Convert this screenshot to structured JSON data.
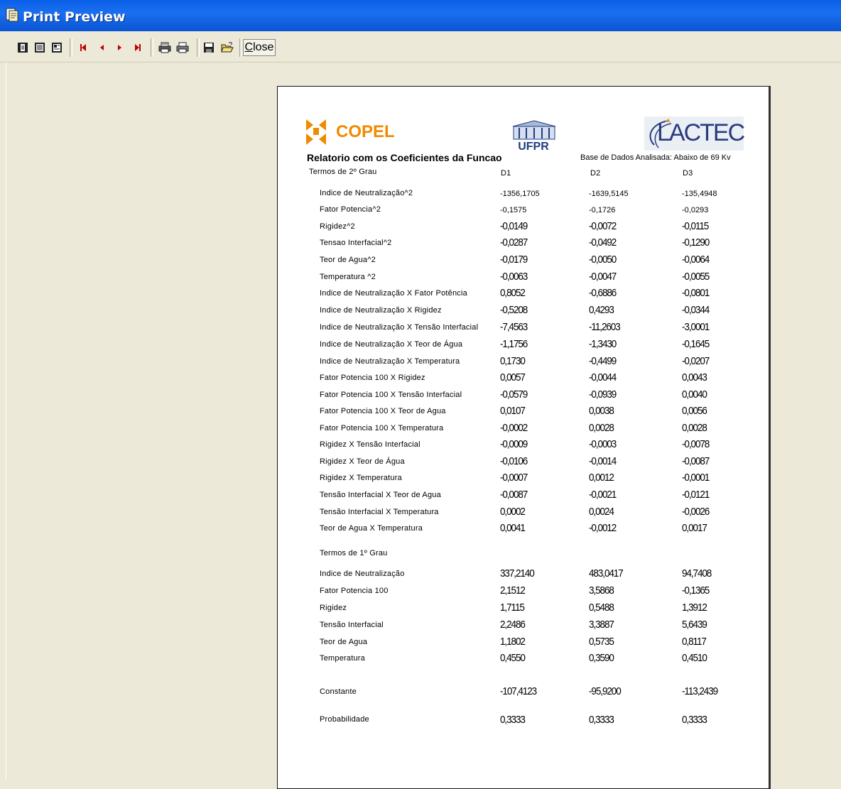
{
  "window": {
    "title": "Print Preview"
  },
  "toolbar": {
    "buttons": [
      {
        "icon": "one-page-icon"
      },
      {
        "icon": "two-pages-icon"
      },
      {
        "icon": "zoom-page-icon"
      },
      {
        "icon": "first-page-icon"
      },
      {
        "icon": "previous-page-icon"
      },
      {
        "icon": "next-page-icon"
      },
      {
        "icon": "last-page-icon"
      },
      {
        "icon": "print-setup-icon"
      },
      {
        "icon": "print-icon"
      },
      {
        "icon": "save-icon"
      },
      {
        "icon": "open-icon"
      }
    ],
    "close_label_accel": "C",
    "close_label_rest": "lose"
  },
  "report": {
    "logos": {
      "copel": "COPEL",
      "ufpr": "UFPR",
      "lactec": "LACTEC"
    },
    "title": "Relatorio com os Coeficientes da Funcao",
    "base": "Base de Dados Analisada: Abaixo de 69 Kv",
    "section1": "Termos de 2º Grau",
    "section2": "Termos de 1º Grau",
    "columns": [
      "D1",
      "D2",
      "D3"
    ],
    "rows_grau2": [
      {
        "label": "Indice de Neutralização^2",
        "values": [
          "-1356,1705",
          "-1639,5145",
          "-135,4948"
        ]
      },
      {
        "label": "Fator Potencia^2",
        "values": [
          "-0,1575",
          "-0,1726",
          "-0,0293"
        ]
      },
      {
        "label": "Rigidez^2",
        "values": [
          "-0,0149",
          "-0,0072",
          "-0,0115"
        ]
      },
      {
        "label": "Tensao Interfacial^2",
        "values": [
          "-0,0287",
          "-0,0492",
          "-0,1290"
        ]
      },
      {
        "label": "Teor de Agua^2",
        "values": [
          "-0,0179",
          "-0,0050",
          "-0,0064"
        ]
      },
      {
        "label": "Temperatura ^2",
        "values": [
          "-0,0063",
          "-0,0047",
          "-0,0055"
        ]
      },
      {
        "label": "Indice de Neutralização X Fator Potência",
        "values": [
          "0,8052",
          "-0,6886",
          "-0,0801"
        ]
      },
      {
        "label": "Indice de Neutralização X Rigidez",
        "values": [
          "-0,5208",
          "0,4293",
          "-0,0344"
        ]
      },
      {
        "label": "Indice de Neutralização X Tensão Interfacial",
        "values": [
          "-7,4563",
          "-11,2603",
          "-3,0001"
        ]
      },
      {
        "label": "Indice de Neutralização X Teor de Água",
        "values": [
          "-1,1756",
          "-1,3430",
          "-0,1645"
        ]
      },
      {
        "label": "Indice de Neutralização X Temperatura",
        "values": [
          "0,1730",
          "-0,4499",
          "-0,0207"
        ]
      },
      {
        "label": "Fator Potencia 100 X Rigidez",
        "values": [
          "0,0057",
          "-0,0044",
          "0,0043"
        ]
      },
      {
        "label": "Fator Potencia 100 X Tensão Interfacial",
        "values": [
          "-0,0579",
          "-0,0939",
          "0,0040"
        ]
      },
      {
        "label": "Fator Potencia 100 X Teor de Agua",
        "values": [
          "0,0107",
          "0,0038",
          "0,0056"
        ]
      },
      {
        "label": "Fator Potencia 100 X Temperatura",
        "values": [
          "-0,0002",
          "0,0028",
          "0,0028"
        ]
      },
      {
        "label": "Rigidez X Tensão Interfacial",
        "values": [
          "-0,0009",
          "-0,0003",
          "-0,0078"
        ]
      },
      {
        "label": "Rigidez X Teor de Água",
        "values": [
          "-0,0106",
          "-0,0014",
          "-0,0087"
        ]
      },
      {
        "label": "Rigidez X Temperatura",
        "values": [
          "-0,0007",
          "0,0012",
          "-0,0001"
        ]
      },
      {
        "label": "Tensão Interfacial X Teor de Agua",
        "values": [
          "-0,0087",
          "-0,0021",
          "-0,0121"
        ]
      },
      {
        "label": "Tensão Interfacial X Temperatura",
        "values": [
          "0,0002",
          "0,0024",
          "-0,0026"
        ]
      },
      {
        "label": "Teor de Agua X Temperatura",
        "values": [
          "0,0041",
          "-0,0012",
          "0,0017"
        ]
      }
    ],
    "rows_grau1": [
      {
        "label": "Indice de Neutralização",
        "values": [
          "337,2140",
          "483,0417",
          "94,7408"
        ]
      },
      {
        "label": "Fator Potencia 100",
        "values": [
          "2,1512",
          "3,5868",
          "-0,1365"
        ]
      },
      {
        "label": "Rigidez",
        "values": [
          "1,7115",
          "0,5488",
          "1,3912"
        ]
      },
      {
        "label": "Tensão Interfacial",
        "values": [
          "2,2486",
          "3,3887",
          "5,6439"
        ]
      },
      {
        "label": "Teor de Agua",
        "values": [
          "1,1802",
          "0,5735",
          "0,8117"
        ]
      },
      {
        "label": "Temperatura",
        "values": [
          "0,4550",
          "0,3590",
          "0,4510"
        ]
      }
    ],
    "constante": {
      "label": "Constante",
      "values": [
        "-107,4123",
        "-95,9200",
        "-113,2439"
      ]
    },
    "probabilidade": {
      "label": "Probabilidade",
      "values": [
        "0,3333",
        "0,3333",
        "0,3333"
      ]
    }
  }
}
